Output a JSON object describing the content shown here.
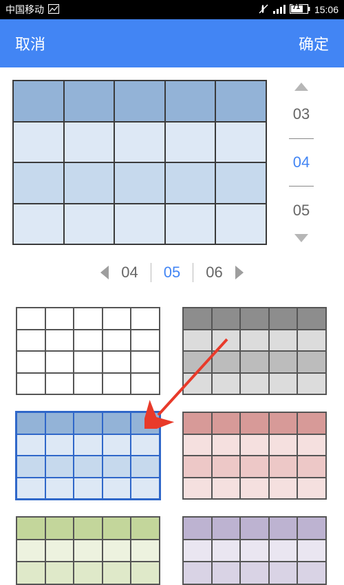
{
  "status_bar": {
    "carrier": "中国移动",
    "time": "15:06",
    "battery": "71"
  },
  "header": {
    "cancel": "取消",
    "confirm": "确定"
  },
  "row_picker": {
    "prev": "03",
    "current": "04",
    "next": "05"
  },
  "col_picker": {
    "prev": "04",
    "current": "05",
    "next": "06"
  },
  "preview_theme": "blue",
  "palettes": [
    {
      "name": "white",
      "dark": "#ffffff",
      "mid": "#ffffff",
      "light": "#ffffff",
      "selected": false
    },
    {
      "name": "gray",
      "dark": "#8d8d8d",
      "mid": "#bcbcbc",
      "light": "#dcdcdc",
      "selected": false
    },
    {
      "name": "blue",
      "dark": "#93b3d7",
      "mid": "#c6d9ed",
      "light": "#dde8f5",
      "selected": true
    },
    {
      "name": "red",
      "dark": "#d79a98",
      "mid": "#edc8c7",
      "light": "#f5e0df",
      "selected": false
    },
    {
      "name": "green",
      "dark": "#c3d69b",
      "mid": "#dfe9c9",
      "light": "#edf2df",
      "selected": false,
      "partial": true
    },
    {
      "name": "purple",
      "dark": "#bdb3d1",
      "mid": "#d9d3e5",
      "light": "#eae6f1",
      "selected": false,
      "partial": true
    }
  ],
  "annotation_arrow": {
    "color": "#e83a2a"
  }
}
